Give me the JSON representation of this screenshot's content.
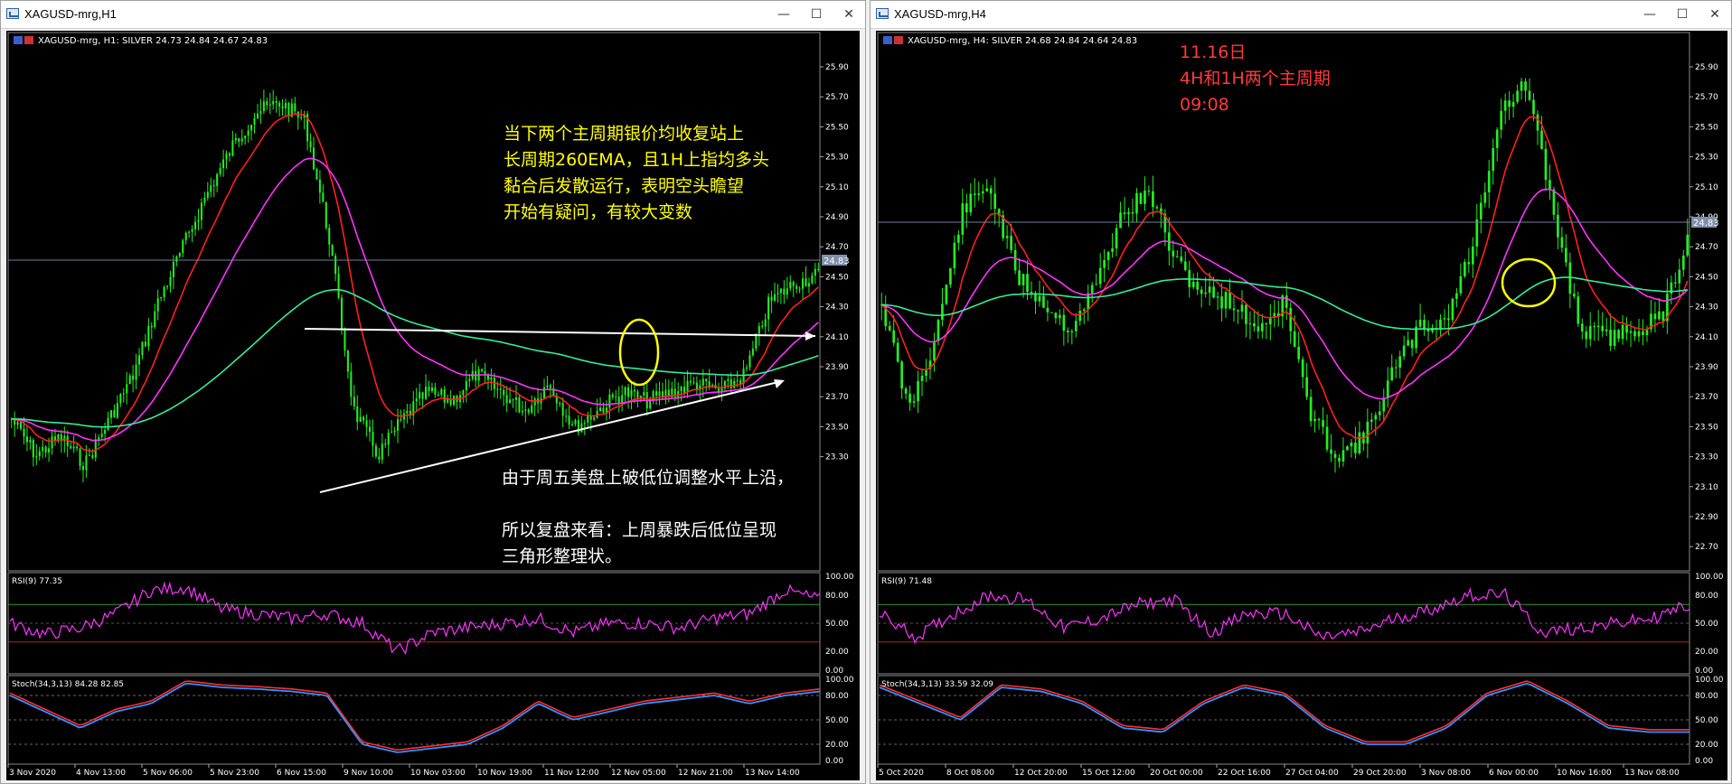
{
  "colors": {
    "background": "#000000",
    "candle": "#22ee22",
    "ema_red": "#ff2020",
    "ema_magenta": "#ff33ff",
    "ema_teal": "#33ee99",
    "grid_text": "#ffffff",
    "annotation_yellow": "#ffff00",
    "annotation_red": "#ff3b3b",
    "marker_circle": "#ffff00"
  },
  "left_window": {
    "title": "XAGUSD-mrg,H1",
    "info": "XAGUSD-mrg, H1:  SILVER  24.73 24.84 24.67 24.83",
    "price_labels": [
      "25.90",
      "25.70",
      "25.50",
      "25.30",
      "25.10",
      "24.90",
      "24.70",
      "24.50",
      "24.30",
      "24.10",
      "23.90",
      "23.70",
      "23.50",
      "23.30"
    ],
    "current_price": "24.83",
    "annotation_yellow": [
      "当下两个主周期银价均收复站上",
      "长周期260EMA，且1H上指均多头",
      "黏合后发散运行，表明空头瞻望",
      "开始有疑问，有较大变数"
    ],
    "annotation_white": [
      "由于周五美盘上破低位调整水平上沿，",
      "所以复盘来看：上周暴跌后低位呈现",
      "三角形整理状。"
    ],
    "rsi_label": "RSI(9) 77.35",
    "stoch_label": "Stoch(34,3,13) 84.28 82.85",
    "osc_levels": [
      "100.00",
      "80.00",
      "50.00",
      "20.00",
      "0.00"
    ],
    "time_labels": [
      "3 Nov 2020",
      "4 Nov 13:00",
      "5 Nov 06:00",
      "5 Nov 23:00",
      "6 Nov 15:00",
      "9 Nov 10:00",
      "10 Nov 03:00",
      "10 Nov 19:00",
      "11 Nov 12:00",
      "12 Nov 05:00",
      "12 Nov 21:00",
      "13 Nov 14:00"
    ]
  },
  "right_window": {
    "title": "XAGUSD-mrg,H4",
    "info": "XAGUSD-mrg, H4:  SILVER  24.68 24.84 24.64 24.83",
    "price_labels": [
      "25.90",
      "25.70",
      "25.50",
      "25.30",
      "25.10",
      "24.90",
      "24.70",
      "24.50",
      "24.30",
      "24.10",
      "23.90",
      "23.70",
      "23.50",
      "23.30",
      "23.10",
      "22.90",
      "22.70"
    ],
    "current_price": "24.83",
    "annotation_red": [
      "11.16日",
      "4H和1H两个主周期",
      "09:08"
    ],
    "rsi_label": "RSI(9) 71.48",
    "stoch_label": "Stoch(34,3,13) 33.59 32.09",
    "osc_levels": [
      "100.00",
      "80.00",
      "50.00",
      "20.00",
      "0.00"
    ],
    "time_labels": [
      "5 Oct 2020",
      "8 Oct 08:00",
      "12 Oct 20:00",
      "15 Oct 12:00",
      "20 Oct 00:00",
      "22 Oct 16:00",
      "27 Oct 04:00",
      "29 Oct 20:00",
      "3 Nov 08:00",
      "6 Nov 00:00",
      "10 Nov 16:00",
      "13 Nov 08:00"
    ]
  }
}
